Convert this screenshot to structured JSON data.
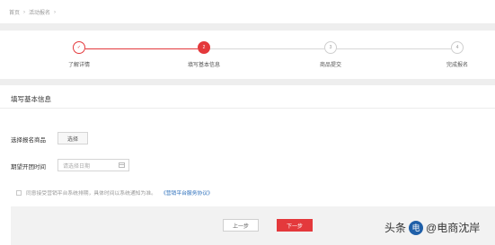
{
  "breadcrumb": {
    "items": [
      "首页",
      "活动报名"
    ]
  },
  "steps": [
    {
      "number": "✓",
      "label": "了解详情",
      "state": "done"
    },
    {
      "number": "2",
      "label": "填写基本信息",
      "state": "active"
    },
    {
      "number": "3",
      "label": "商品提交",
      "state": "todo"
    },
    {
      "number": "4",
      "label": "完成报名",
      "state": "todo"
    }
  ],
  "form": {
    "section_title": "填写基本信息",
    "product_label": "选择报名商品",
    "select_button": "选择",
    "date_label": "期望开团时间",
    "date_placeholder": "请选择日期",
    "agree_text": "同意接受营销平台系统排期，具体时间以系统通知为准。",
    "agree_link": "《营销平台服务协议》"
  },
  "footer": {
    "prev_label": "上一步",
    "next_label": "下一步"
  },
  "watermark": {
    "prefix": "头条",
    "author": "@电商沈岸",
    "avatar_text": "电"
  },
  "colors": {
    "accent": "#e4393c",
    "link": "#2a6ebb"
  }
}
